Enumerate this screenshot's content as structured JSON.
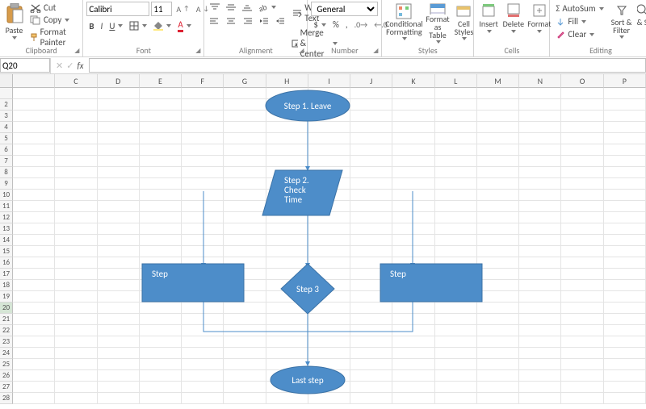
{
  "clipboard": {
    "title": "Clipboard",
    "paste": "Paste",
    "cut": "Cut",
    "copy": "Copy",
    "format_painter": "Format Painter"
  },
  "font": {
    "title": "Font",
    "name": "Calibri",
    "size": "11"
  },
  "alignment": {
    "title": "Alignment",
    "wrap": "Wrap Text",
    "merge": "Merge & Center"
  },
  "number": {
    "title": "Number",
    "format": "General"
  },
  "styles": {
    "title": "Styles",
    "cond": "Conditional Formatting",
    "as_table": "Format as Table",
    "cell": "Cell Styles"
  },
  "cells_grp": {
    "title": "Cells",
    "insert": "Insert",
    "delete": "Delete",
    "format": "Format"
  },
  "editing": {
    "title": "Editing",
    "sum": "AutoSum",
    "fill": "Fill",
    "clear": "Clear",
    "sort": "Sort & Filter",
    "find": "Find & Select"
  },
  "namebox": "Q20",
  "columns": [
    "",
    "C",
    "D",
    "E",
    "F",
    "G",
    "H",
    "I",
    "J",
    "K",
    "L",
    "M",
    "N",
    "O",
    "P"
  ],
  "rows": [
    "",
    "2",
    "3",
    "4",
    "5",
    "6",
    "7",
    "8",
    "9",
    "10",
    "11",
    "12",
    "13",
    "14",
    "15",
    "16",
    "17",
    "18",
    "19",
    "20",
    "21",
    "22",
    "23",
    "24",
    "25",
    "26",
    "27",
    "28"
  ],
  "flow": {
    "step1": "Step 1. Leave",
    "step2": "Step 2. Check Time",
    "step3": "Step 3",
    "stepL": "Step",
    "stepR": "Step",
    "last": "Last step"
  }
}
